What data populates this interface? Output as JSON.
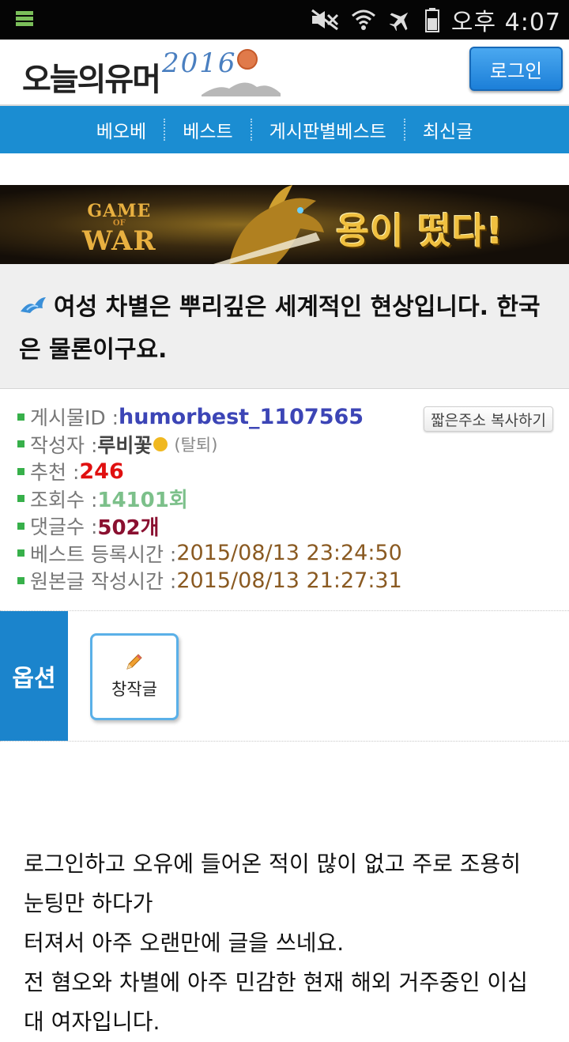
{
  "status_bar": {
    "time": "오후 4:07"
  },
  "header": {
    "logo_text": "오늘의유머",
    "logo_year": "2016",
    "login_label": "로그인"
  },
  "nav": {
    "items": [
      "베오베",
      "베스트",
      "게시판별베스트",
      "최신글"
    ]
  },
  "banner": {
    "game_top": "GAME",
    "game_of": "OF",
    "game_bottom": "WAR",
    "tagline": "용이 떴다!"
  },
  "post": {
    "title": "여성 차별은 뿌리깊은 세계적인 현상입니다. 한국은 물론이구요.",
    "copy_short_url_label": "짧은주소 복사하기",
    "fields": {
      "id_label": "게시물ID : ",
      "id_value": "humorbest_1107565",
      "author_label": "작성자 : ",
      "author_value": "루비꽃",
      "author_status": "(탈퇴)",
      "rec_label": "추천 : ",
      "rec_value": "246",
      "views_label": "조회수 : ",
      "views_value": "14101회",
      "comments_label": "댓글수 : ",
      "comments_value": "502개",
      "best_time_label": "베스트 등록시간 : ",
      "best_time_value": "2015/08/13 23:24:50",
      "orig_time_label": "원본글 작성시간 : ",
      "orig_time_value": "2015/08/13 21:27:31"
    }
  },
  "options": {
    "label": "옵션",
    "original_label": "창작글"
  },
  "body": {
    "lines": [
      "로그인하고 오유에 들어온 적이 많이 없고 주로 조용히 눈팅만 하다가",
      "터져서 아주 오랜만에 글을 쓰네요.",
      "전 혐오와 차별에 아주 민감한 현재 해외 거주중인 이십대 여자입니다."
    ]
  },
  "colors": {
    "nav_blue": "#1b8dd2",
    "option_blue": "#1b84cc",
    "id_blue": "#3c45b6",
    "rec_red": "#e01010"
  }
}
